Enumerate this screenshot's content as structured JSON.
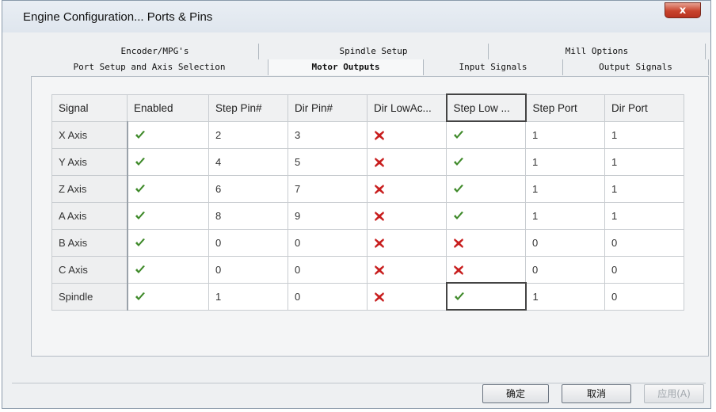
{
  "window": {
    "title": "Engine Configuration... Ports & Pins",
    "close_label": "x"
  },
  "tabs": {
    "back_row": [
      "Encoder/MPG's",
      "Spindle Setup",
      "Mill Options"
    ],
    "front_row": [
      "Port Setup and Axis Selection",
      "Motor Outputs",
      "Input Signals",
      "Output Signals"
    ],
    "active": "Motor Outputs"
  },
  "table": {
    "columns": [
      "Signal",
      "Enabled",
      "Step Pin#",
      "Dir Pin#",
      "Dir LowAc...",
      "Step Low ...",
      "Step Port",
      "Dir Port"
    ],
    "rows": [
      {
        "signal": "X Axis",
        "enabled": true,
        "step_pin": "2",
        "dir_pin": "3",
        "dir_low": false,
        "step_low": true,
        "step_port": "1",
        "dir_port": "1"
      },
      {
        "signal": "Y Axis",
        "enabled": true,
        "step_pin": "4",
        "dir_pin": "5",
        "dir_low": false,
        "step_low": true,
        "step_port": "1",
        "dir_port": "1"
      },
      {
        "signal": "Z Axis",
        "enabled": true,
        "step_pin": "6",
        "dir_pin": "7",
        "dir_low": false,
        "step_low": true,
        "step_port": "1",
        "dir_port": "1"
      },
      {
        "signal": "A Axis",
        "enabled": true,
        "step_pin": "8",
        "dir_pin": "9",
        "dir_low": false,
        "step_low": true,
        "step_port": "1",
        "dir_port": "1"
      },
      {
        "signal": "B Axis",
        "enabled": true,
        "step_pin": "0",
        "dir_pin": "0",
        "dir_low": false,
        "step_low": false,
        "step_port": "0",
        "dir_port": "0"
      },
      {
        "signal": "C Axis",
        "enabled": true,
        "step_pin": "0",
        "dir_pin": "0",
        "dir_low": false,
        "step_low": false,
        "step_port": "0",
        "dir_port": "0"
      },
      {
        "signal": "Spindle",
        "enabled": true,
        "step_pin": "1",
        "dir_pin": "0",
        "dir_low": false,
        "step_low": true,
        "step_port": "1",
        "dir_port": "0"
      }
    ]
  },
  "buttons": {
    "ok": "确定",
    "cancel": "取消",
    "apply": "应用(A)"
  },
  "colors": {
    "check": "#3f8a2a",
    "cross": "#c81e1e"
  }
}
